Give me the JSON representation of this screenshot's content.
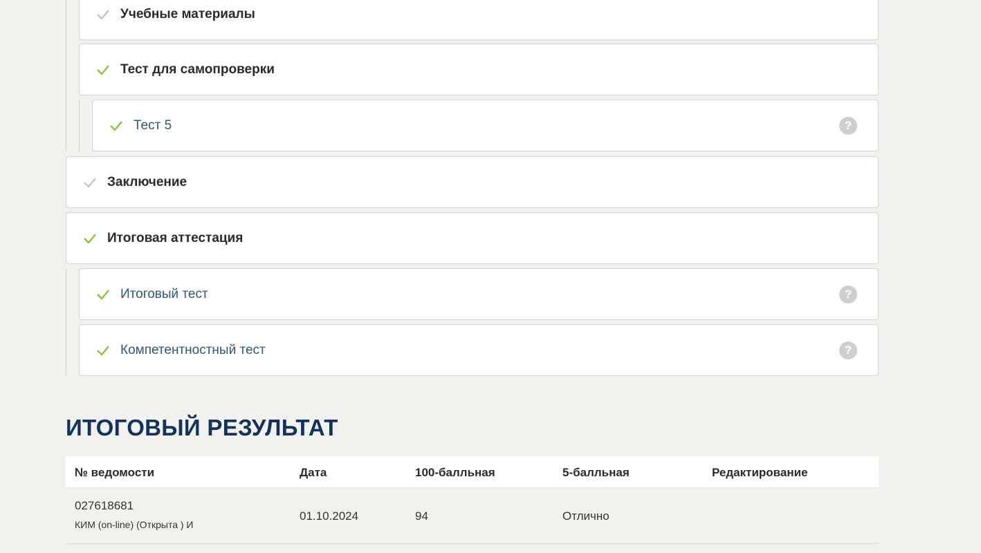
{
  "outline": {
    "learning_materials": {
      "label": "Учебные материалы",
      "completed": false
    },
    "self_test_section": {
      "label": "Тест для самопроверки",
      "completed": true
    },
    "test5": {
      "label": "Тест 5",
      "completed": true,
      "help": "?"
    },
    "conclusion": {
      "label": "Заключение",
      "completed": false
    },
    "final_attestation": {
      "label": "Итоговая аттестация",
      "completed": true
    },
    "final_test": {
      "label": "Итоговый тест",
      "completed": true,
      "help": "?"
    },
    "competency_test": {
      "label": "Компетентностный тест",
      "completed": true,
      "help": "?"
    }
  },
  "result": {
    "title": "ИТОГОВЫЙ РЕЗУЛЬТАТ",
    "columns": {
      "record_no": "№ ведомости",
      "date": "Дата",
      "score100": "100-балльная",
      "score5": "5-балльная",
      "edit": "Редактирование"
    },
    "rows": [
      {
        "record_no": "027618681",
        "record_sub": "КИМ (on-line) (Открыта ) И",
        "date": "01.10.2024",
        "score100": "94",
        "score5": "Отлично",
        "edit": ""
      }
    ]
  },
  "colors": {
    "check_done": "#86c440",
    "check_pending": "#c4c4c4",
    "title": "#12335c",
    "item_link": "#2d5876"
  }
}
